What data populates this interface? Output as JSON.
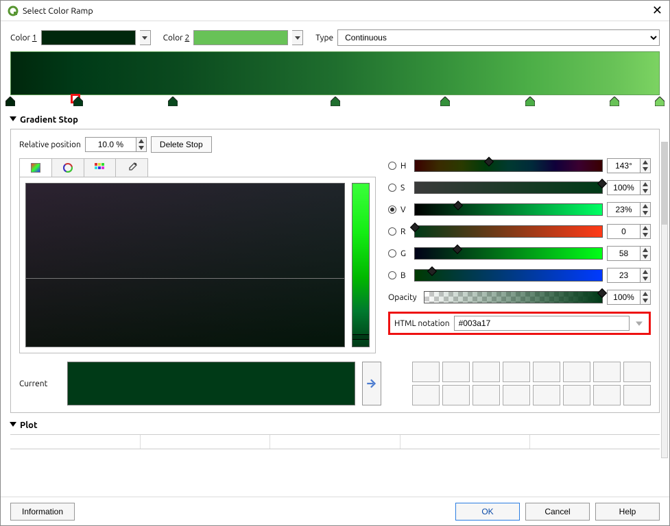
{
  "window": {
    "title": "Select Color Ramp"
  },
  "labels": {
    "color1": "Color 1",
    "color2": "Color 2",
    "type": "Type",
    "gradient_stop": "Gradient Stop",
    "relative_position": "Relative position",
    "delete_stop": "Delete Stop",
    "html_notation": "HTML notation",
    "current": "Current",
    "plot": "Plot",
    "information": "Information",
    "ok": "OK",
    "cancel": "Cancel",
    "help": "Help",
    "opacity": "Opacity"
  },
  "type_value": "Continuous",
  "color1_hex": "#00270c",
  "color2_hex": "#68c257",
  "relative_position_value": "10.0 %",
  "stops_pct": [
    0,
    10,
    25,
    50,
    67,
    80,
    93,
    100
  ],
  "selected_stop_index": 1,
  "selected_stop_hex": "#003a17",
  "channels": {
    "h": {
      "label": "H",
      "value": "143°",
      "pct": 39.7,
      "selected": false,
      "gradient": "linear-gradient(to right,#3a0000,#3a2a00,#2a3a00,#003a0a,#003a30,#002a3a,#10003a,#3a0030,#3a0000)"
    },
    "s": {
      "label": "S",
      "value": "100%",
      "pct": 100,
      "selected": false,
      "gradient": "linear-gradient(to right,#3a3a3a,#003a17)"
    },
    "v": {
      "label": "V",
      "value": "23%",
      "pct": 23,
      "selected": true,
      "gradient": "linear-gradient(to right,#000000,#00ff63)"
    },
    "r": {
      "label": "R",
      "value": "0",
      "pct": 0,
      "selected": false,
      "gradient": "linear-gradient(to right,#003a17,#ff3a17)"
    },
    "g": {
      "label": "G",
      "value": "58",
      "pct": 22.7,
      "selected": false,
      "gradient": "linear-gradient(to right,#000017,#00ff17)"
    },
    "b": {
      "label": "B",
      "value": "23",
      "pct": 9.0,
      "selected": false,
      "gradient": "linear-gradient(to right,#003a00,#003aff)"
    },
    "opacity": {
      "value": "100%",
      "pct": 100
    }
  },
  "html_notation_value": "#003a17",
  "current_hex": "#003a17",
  "icons": {
    "app": "qgis-q",
    "close": "close-x",
    "dropdown": "chevron-down",
    "spin_up": "triangle-up",
    "spin_down": "triangle-down",
    "section_collapse": "triangle-down-filled",
    "tab_gradient": "gradient-square",
    "tab_wheel": "color-wheel",
    "tab_swatches": "swatch-grid",
    "tab_eyedrop": "eyedropper",
    "arrow_right": "arrow-right"
  }
}
